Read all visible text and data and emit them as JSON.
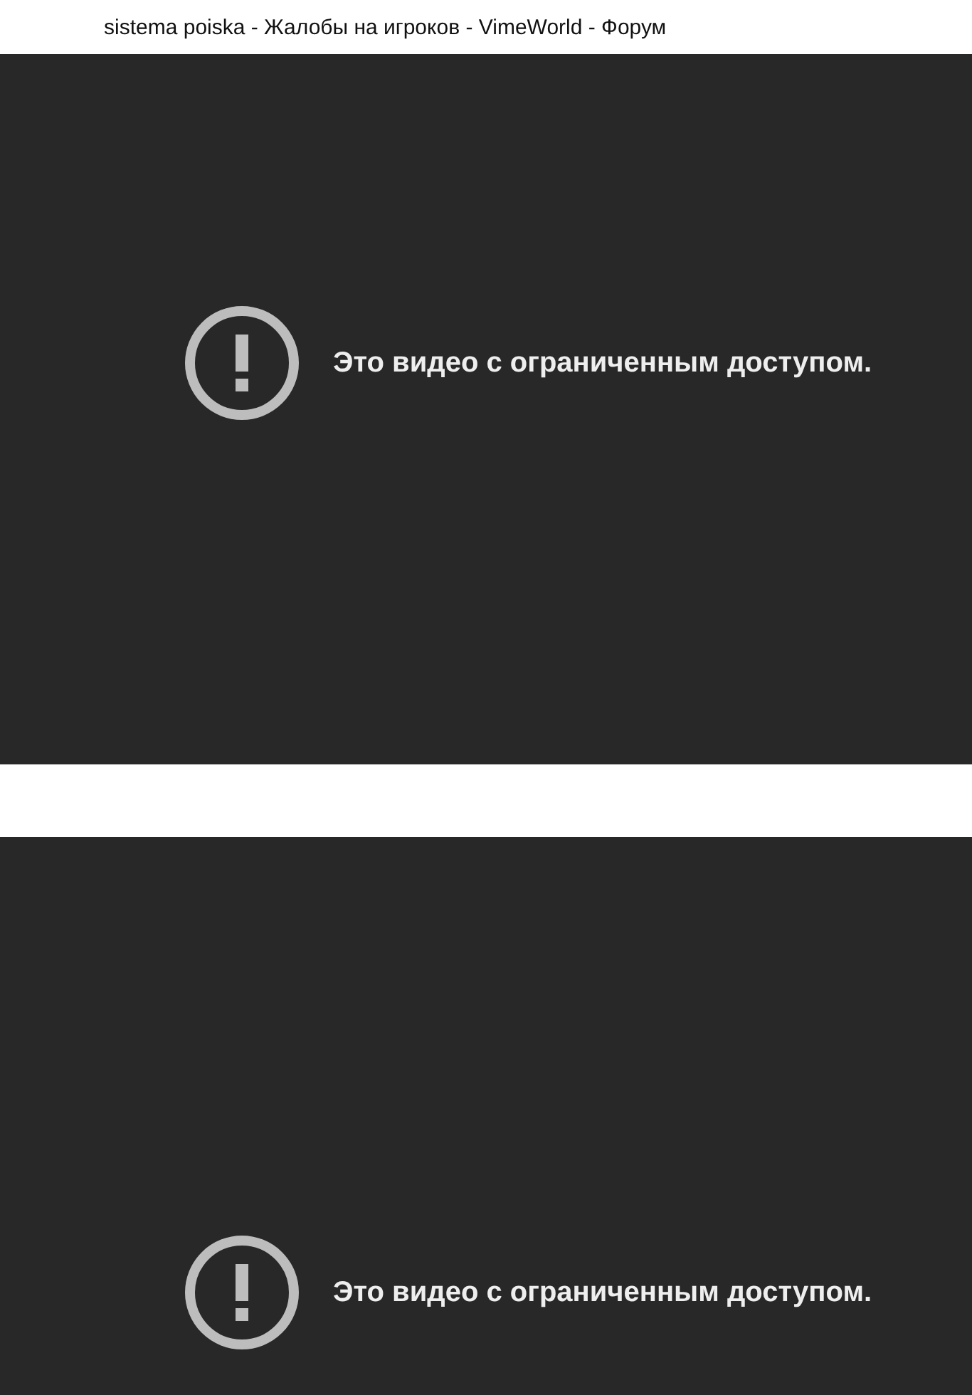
{
  "page_title": "sistema poiska - Жалобы на игроков - VimeWorld - Форум",
  "videos": [
    {
      "message": "Это видео с ограниченным доступом."
    },
    {
      "message": "Это видео с ограниченным доступом."
    }
  ]
}
